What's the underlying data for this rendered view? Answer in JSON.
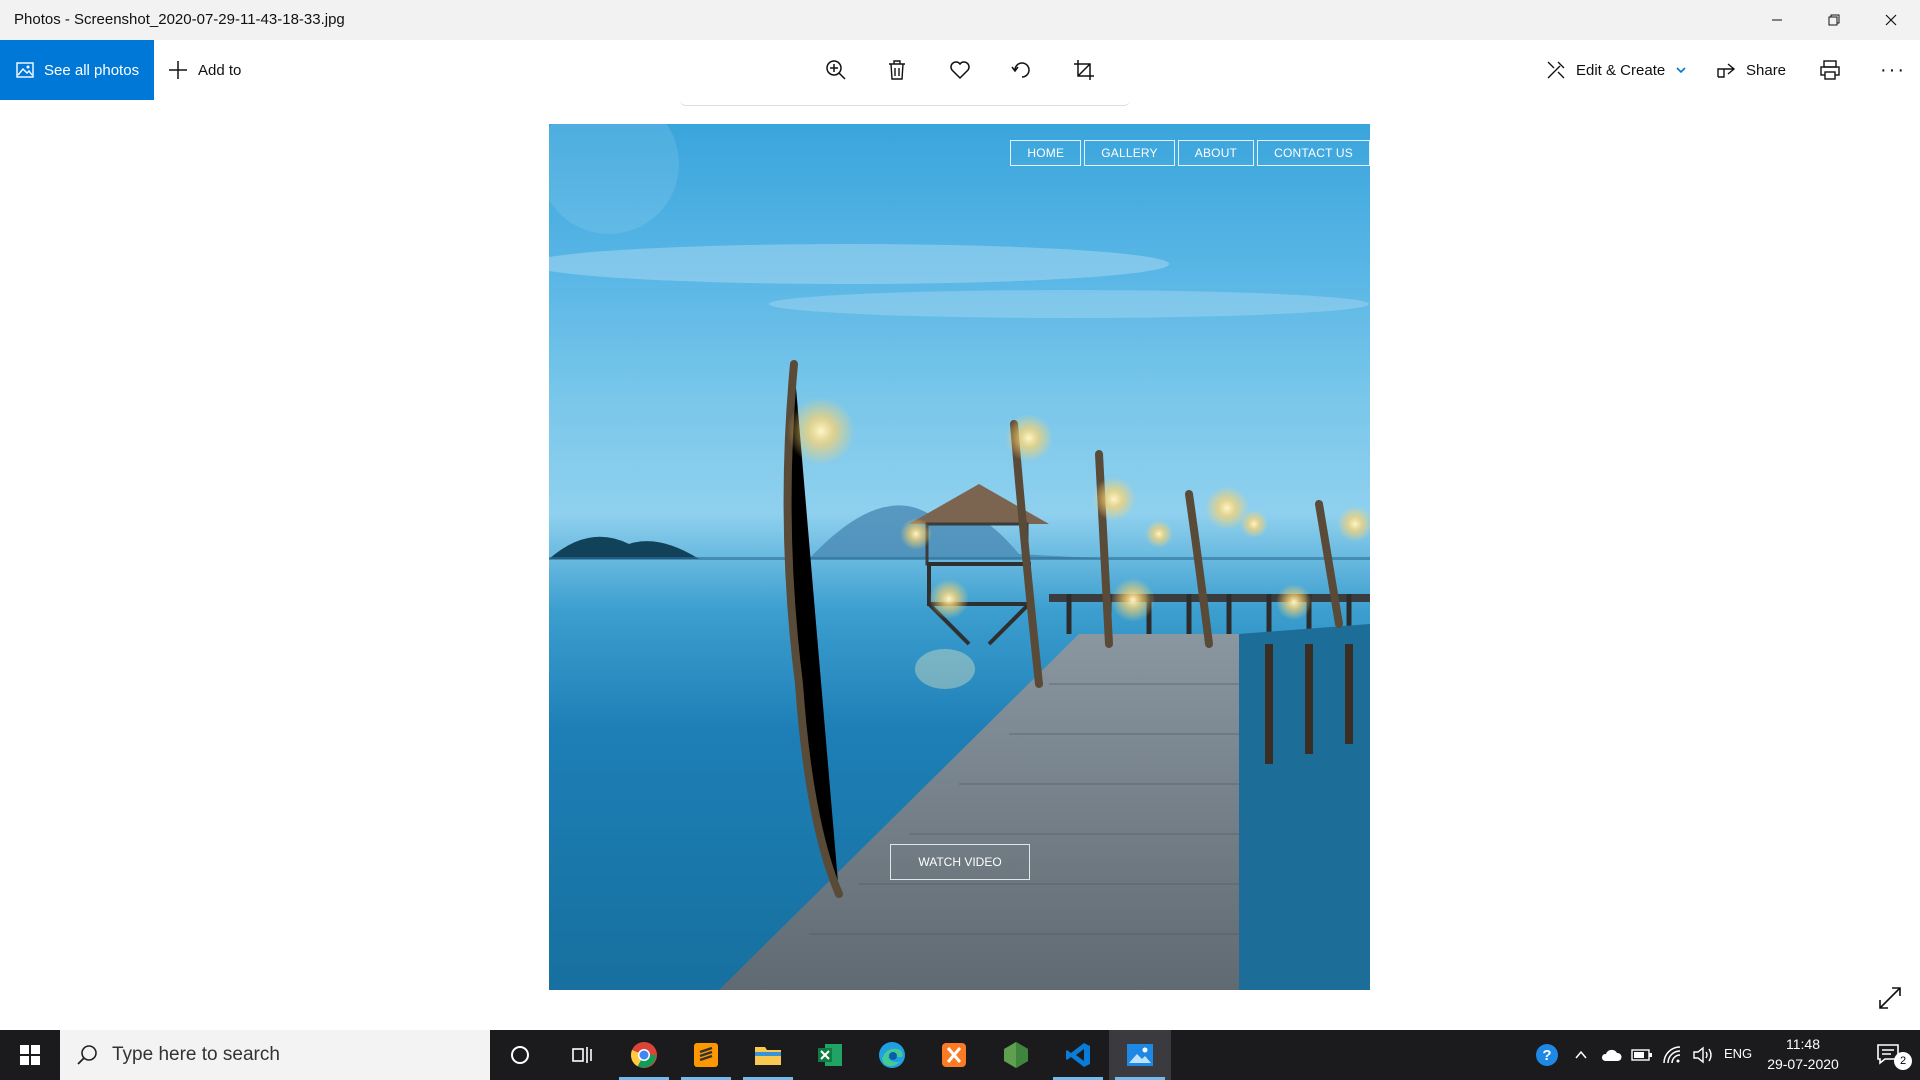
{
  "window": {
    "title": "Photos - Screenshot_2020-07-29-11-43-18-33.jpg"
  },
  "toolbar": {
    "see_all_label": "See all photos",
    "add_to_label": "Add to",
    "edit_create_label": "Edit & Create",
    "share_label": "Share",
    "more_label": "···"
  },
  "photo_site": {
    "nav": [
      "HOME",
      "GALLERY",
      "ABOUT",
      "CONTACT US"
    ],
    "watch_video": "WATCH VIDEO"
  },
  "taskbar": {
    "search_placeholder": "Type here to search",
    "language": "ENG",
    "time": "11:48",
    "date": "29-07-2020",
    "notification_count": "2"
  },
  "colors": {
    "accent": "#0078d7",
    "taskbar": "#1b1b1d"
  }
}
